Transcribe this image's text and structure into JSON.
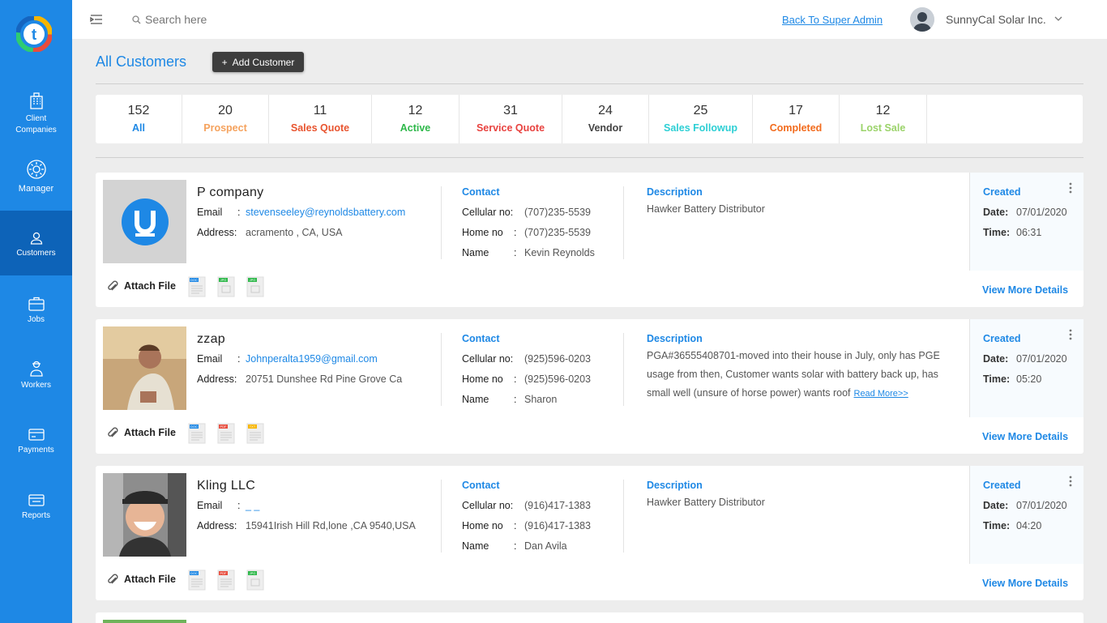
{
  "sidebar": {
    "items": [
      {
        "label": "Client\nCompanies",
        "icon": "building-icon"
      },
      {
        "label": "Manager",
        "icon": "gear-icon"
      },
      {
        "label": "Customers",
        "icon": "user-icon"
      },
      {
        "label": "Jobs",
        "icon": "briefcase-icon"
      },
      {
        "label": "Workers",
        "icon": "workers-icon"
      },
      {
        "label": "Payments",
        "icon": "payment-icon"
      },
      {
        "label": "Reports",
        "icon": "report-icon"
      }
    ],
    "active": "Customers",
    "bg": "#1e88e5",
    "active_bg": "#0d63b8"
  },
  "topbar": {
    "search_placeholder": "Search here",
    "back_link": "Back To Super Admin",
    "company": "SunnyCal Solar Inc."
  },
  "header": {
    "title": "All Customers",
    "add_button": "Add Customer"
  },
  "stats": [
    {
      "num": "152",
      "label": "All",
      "color": "#1e88e5"
    },
    {
      "num": "20",
      "label": "Prospect",
      "color": "#f5a25d"
    },
    {
      "num": "11",
      "label": "Sales Quote",
      "color": "#e8542f"
    },
    {
      "num": "12",
      "label": "Active",
      "color": "#2eb84a"
    },
    {
      "num": "31",
      "label": "Service Quote",
      "color": "#e8423f"
    },
    {
      "num": "24",
      "label": "Vendor",
      "color": "#444444"
    },
    {
      "num": "25",
      "label": "Sales Followup",
      "color": "#2ccfd4"
    },
    {
      "num": "17",
      "label": "Completed",
      "color": "#f26b1d"
    },
    {
      "num": "12",
      "label": "Lost Sale",
      "color": "#9bd36a"
    }
  ],
  "labels": {
    "email": "Email",
    "address": "Address:",
    "contact": "Contact",
    "cellular": "Cellular no:",
    "home": "Home no",
    "name": "Name",
    "description": "Description",
    "created": "Created",
    "date": "Date:",
    "time": "Time:",
    "attach": "Attach File",
    "view_more": "View More Details",
    "read_more": "Read More>>"
  },
  "customers": [
    {
      "name": "P company",
      "email": "stevenseeley@reynoldsbattery.com",
      "address": "acramento , CA, USA",
      "cellular": "(707)235-5539",
      "home": "(707)235-5539",
      "contact_name": "Kevin Reynolds",
      "description": "Hawker Battery Distributor",
      "date": "07/01/2020",
      "time": "06:31",
      "files": [
        "DOC",
        "JPG",
        "JPG"
      ]
    },
    {
      "name": "zzap",
      "email": "Johnperalta1959@gmail.com",
      "address": "20751 Dunshee Rd Pine Grove Ca",
      "cellular": "(925)596-0203",
      "home": "(925)596-0203",
      "contact_name": "Sharon",
      "description": "PGA#36555408701-moved into their house in July, only has PGE usage from then, Customer wants solar with battery back up, has small well (unsure of horse power) wants roof",
      "date": "07/01/2020",
      "time": "05:20",
      "files": [
        "DOC",
        "PDF",
        "TXT"
      ]
    },
    {
      "name": "Kling LLC",
      "email": "_ _",
      "address": "15941Irish Hill Rd,lone ,CA 9540,USA",
      "cellular": "(916)417-1383",
      "home": "(916)417-1383",
      "contact_name": "Dan Avila",
      "description": "Hawker Battery Distributor",
      "date": "07/01/2020",
      "time": "04:20",
      "files": [
        "DOC",
        "PDF",
        "JPG"
      ]
    }
  ]
}
